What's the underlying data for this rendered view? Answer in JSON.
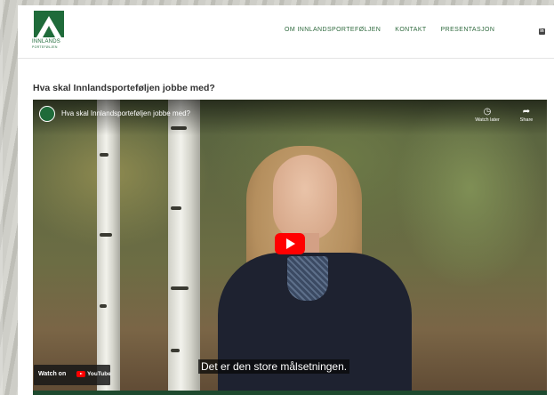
{
  "header": {
    "logo": {
      "name": "INNLANDS",
      "sub": "PORTEFØLJEN"
    },
    "nav": [
      {
        "label": "OM INNLANDSPORTEFØLJEN"
      },
      {
        "label": "KONTAKT"
      },
      {
        "label": "PRESENTASJON"
      }
    ],
    "linkedin_icon": "in"
  },
  "main": {
    "title": "Hva skal Innlandsporteføljen jobbe med?"
  },
  "video": {
    "title": "Hva skal Innlandsporteføljen jobbe med?",
    "watch_later": {
      "label": "Watch later",
      "icon": "clock-icon"
    },
    "share": {
      "label": "Share",
      "icon": "share-arrow-icon"
    },
    "subtitle": "Det er den store målsetningen.",
    "watch_on": {
      "label": "Watch on",
      "brand": "YouTube"
    }
  },
  "colors": {
    "brand_green": "#1f6b3a",
    "nav_green": "#2f6a3e",
    "youtube_red": "#ff0000"
  }
}
